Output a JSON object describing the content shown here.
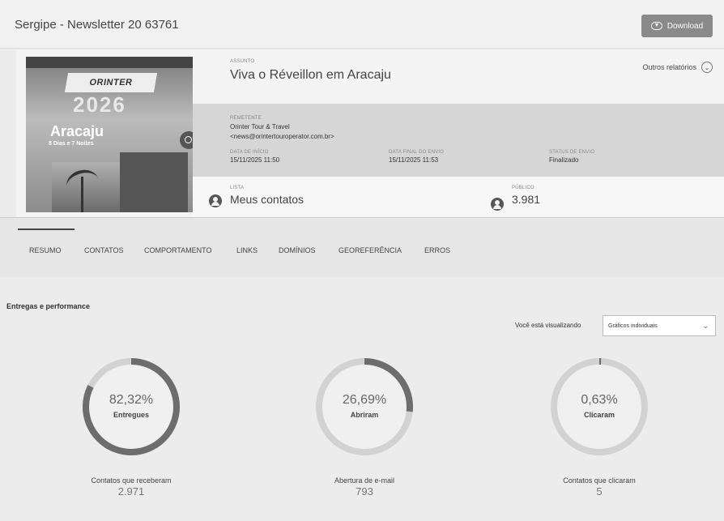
{
  "header": {
    "title": "Sergipe - Newsletter 20 63761",
    "download_label": "Download"
  },
  "thumbnail": {
    "brand": "ORINTER",
    "year": "2026",
    "city": "Aracaju",
    "days": "8 Dias e 7 Noites"
  },
  "campaign": {
    "subject_label": "Assunto",
    "subject": "Viva o Réveillon em Aracaju",
    "other_reports": "Outros relatórios",
    "sender_label": "Remetente",
    "sender_name": "Orinter Tour & Travel",
    "sender_email": "<news@orintertouroperator.com.br>",
    "start_label": "Data de início",
    "start": "15/11/2025 11:50",
    "end_label": "Data final do envio",
    "end": "15/11/2025 11:53",
    "status_label": "Status de envio",
    "status": "Finalizado",
    "list_label": "Lista",
    "list": "Meus contatos",
    "audience_label": "Público",
    "audience": "3.981"
  },
  "tabs": [
    {
      "label": "RESUMO"
    },
    {
      "label": "CONTATOS"
    },
    {
      "label": "COMPORTAMENTO"
    },
    {
      "label": "LINKS"
    },
    {
      "label": "DOMÍNIOS"
    },
    {
      "label": "GEOREFERÊNCIA"
    },
    {
      "label": "ERROS"
    }
  ],
  "performance": {
    "title": "Entregas e performance",
    "viewing_label": "Você está visualizando",
    "view_select": "Gráficos individuais",
    "metrics": [
      {
        "pct_text": "82,32%",
        "pct": 82.32,
        "name": "Entregues",
        "label": "Contatos que receberam",
        "value": "2.971"
      },
      {
        "pct_text": "26,69%",
        "pct": 26.69,
        "name": "Abriram",
        "label": "Abertura de e-mail",
        "value": "793"
      },
      {
        "pct_text": "0,63%",
        "pct": 0.63,
        "name": "Clicaram",
        "label": "Contatos que clicaram",
        "value": "5"
      }
    ]
  },
  "colors": {
    "ring_track": "#d2d2d2",
    "ring_fill": "#6d6d6d",
    "ring_inner": "#f0f0f0"
  }
}
